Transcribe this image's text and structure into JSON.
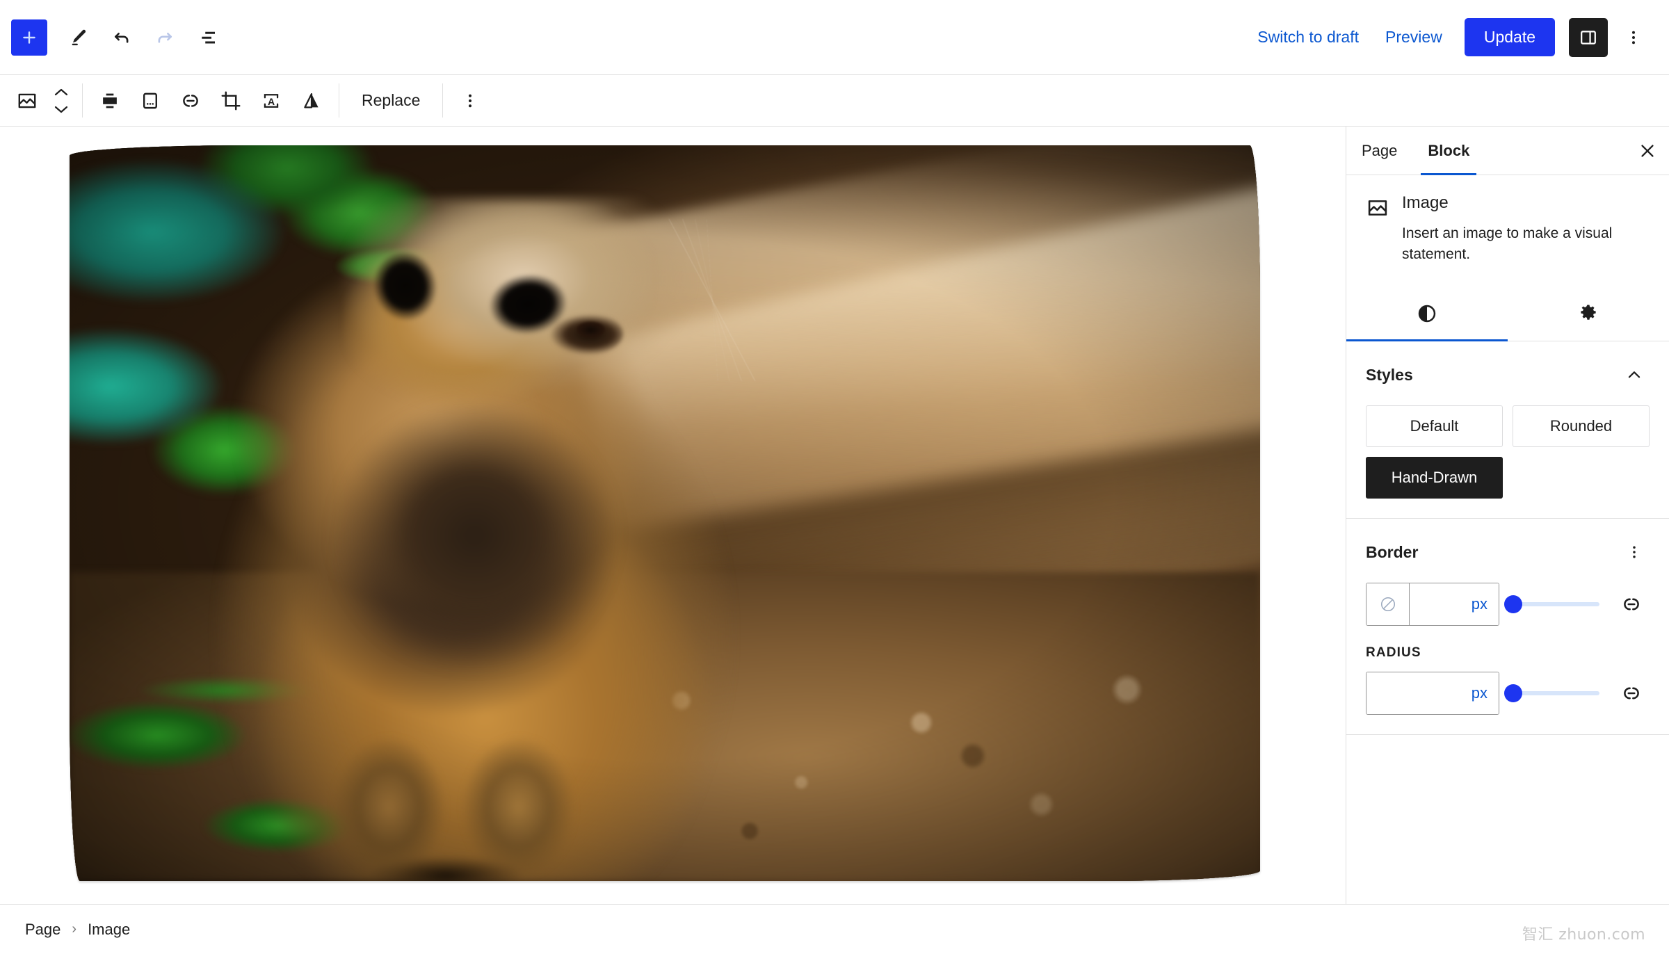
{
  "topbar": {
    "add_label": "Add block",
    "tools_label": "Tools",
    "undo_label": "Undo",
    "redo_label": "Redo",
    "listview_label": "Document Overview",
    "switch_to_draft": "Switch to draft",
    "preview": "Preview",
    "update": "Update",
    "settings_toggle_label": "Settings",
    "options_label": "Options"
  },
  "block_toolbar": {
    "block_type_label": "Image",
    "move_label": "Move",
    "align_label": "Align",
    "align_options_label": "Align options",
    "link_label": "Link",
    "crop_label": "Crop",
    "text_over_label": "Add text over image",
    "filter_label": "Apply duotone filter",
    "replace": "Replace",
    "more_label": "Options"
  },
  "sidebar": {
    "tabs": [
      {
        "label": "Page",
        "active": false
      },
      {
        "label": "Block",
        "active": true
      }
    ],
    "close_label": "Close Settings",
    "block_card": {
      "title": "Image",
      "description": "Insert an image to make a visual statement."
    },
    "icon_tabs": [
      {
        "name": "styles-tab",
        "icon": "contrast-icon",
        "active": true
      },
      {
        "name": "settings-tab",
        "icon": "gear-icon",
        "active": false
      }
    ],
    "styles_panel": {
      "title": "Styles",
      "collapse_label": "Collapse",
      "options": [
        {
          "label": "Default",
          "selected": false
        },
        {
          "label": "Rounded",
          "selected": false
        },
        {
          "label": "Hand-Drawn",
          "selected": true
        }
      ]
    },
    "border_panel": {
      "title": "Border",
      "options_label": "Border options",
      "width": {
        "value": "",
        "placeholder": "",
        "unit": "px",
        "color_label": "Border color",
        "slider_value": 0,
        "link_label": "Unlink sides"
      },
      "radius_label": "RADIUS",
      "radius": {
        "value": "",
        "placeholder": "",
        "unit": "px",
        "slider_value": 0,
        "link_label": "Unlink sides"
      }
    }
  },
  "footer": {
    "breadcrumbs": [
      "Page",
      "Image"
    ],
    "separator": "›"
  },
  "watermark": {
    "text": "智汇 zhuon.com"
  },
  "colors": {
    "accent_blue": "#1d35f0",
    "link_blue": "#0b57d0",
    "tab_underline": "#0b57d0",
    "selected_style_bg": "#1e1e1e",
    "border_gray": "#e0e0e0",
    "slider_track": "#d7e5fa"
  }
}
